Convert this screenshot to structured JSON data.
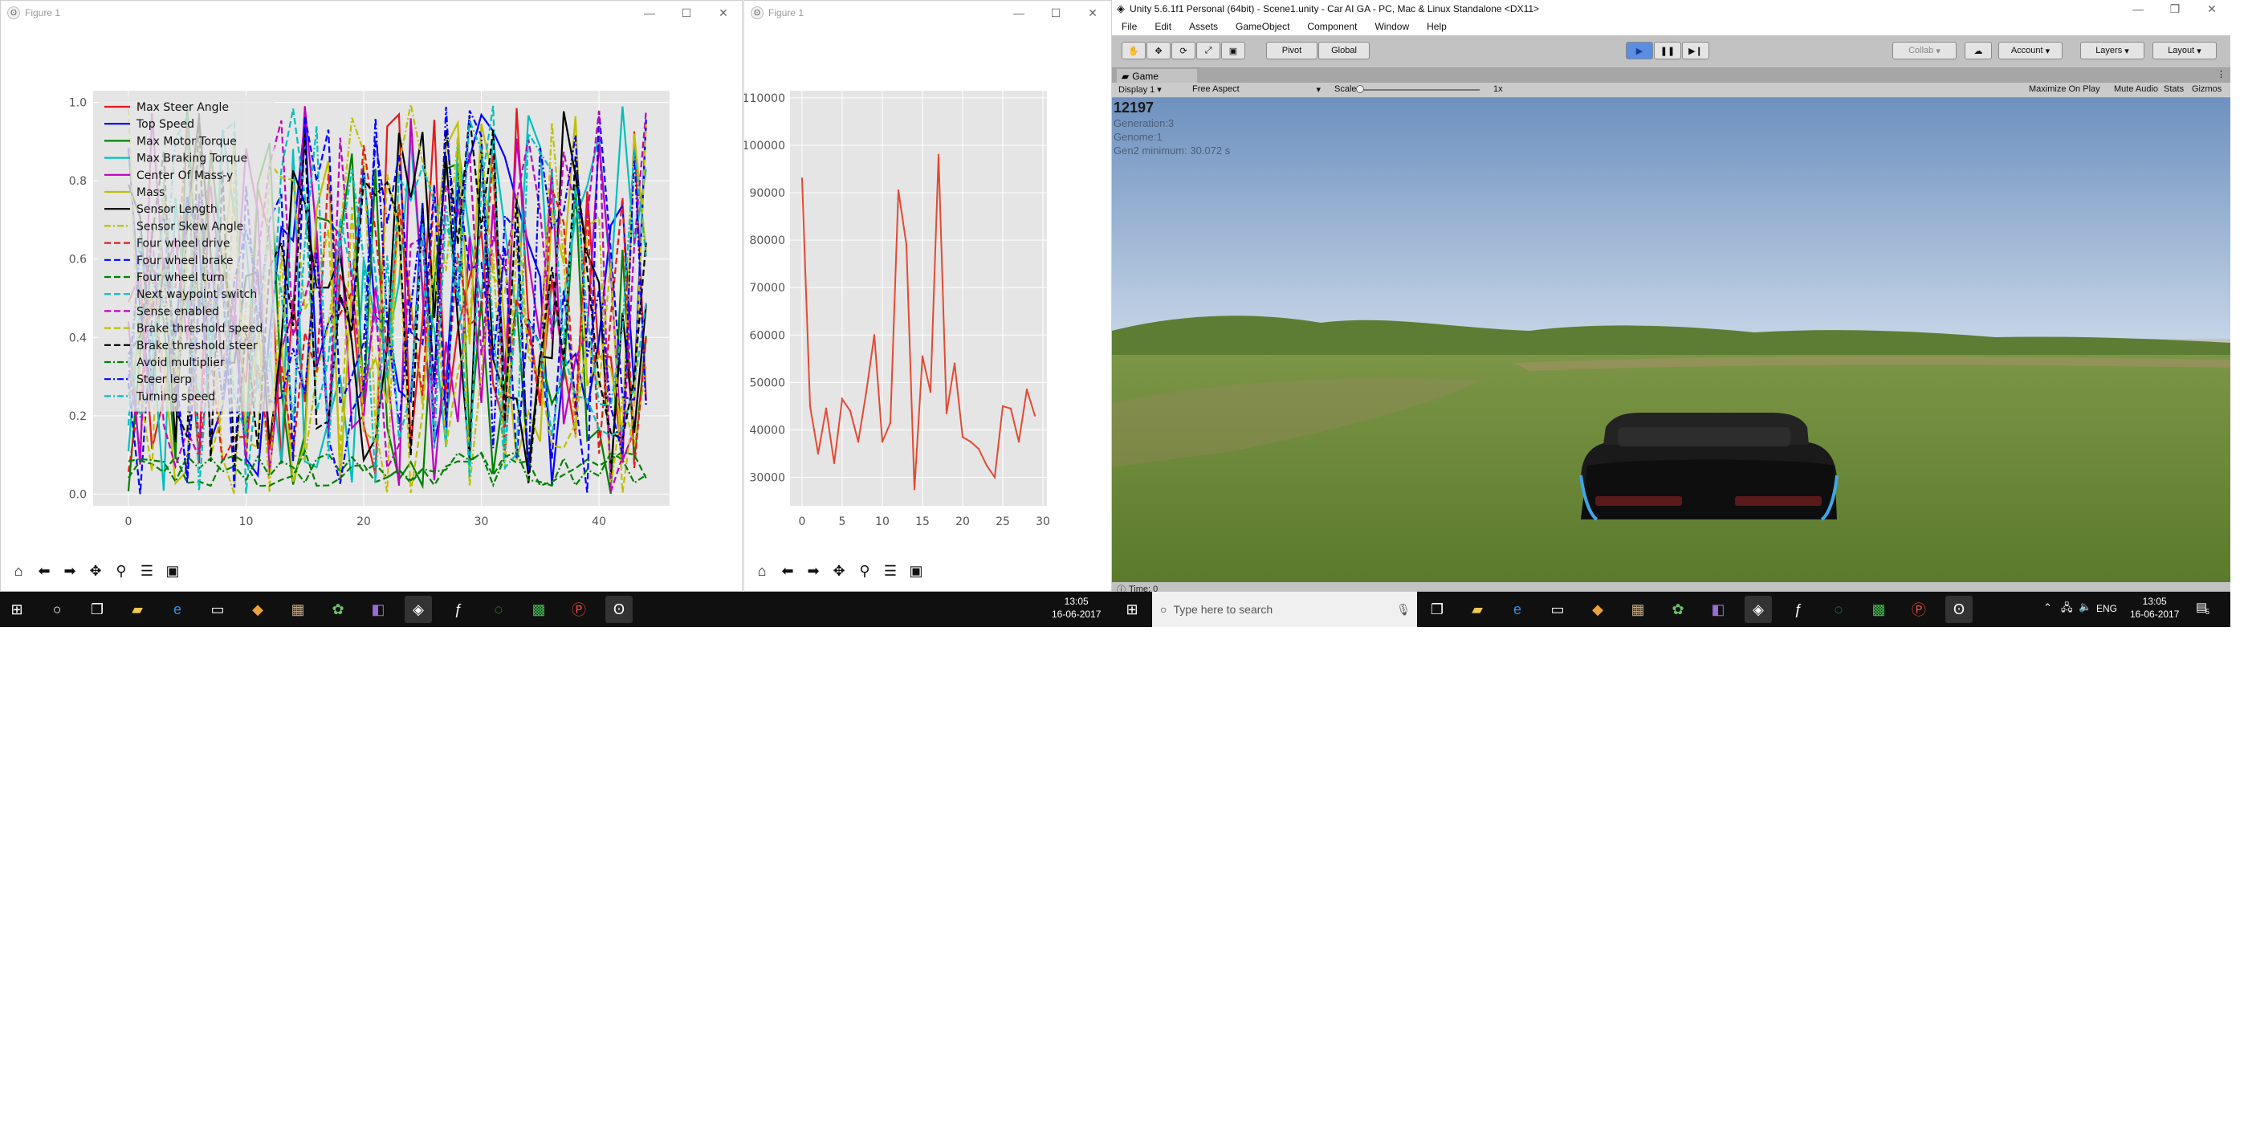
{
  "figure1": {
    "title": "Figure 1",
    "legend": [
      "Max Steer Angle",
      "Top Speed",
      "Max Motor Torque",
      "Max Braking Torque",
      "Center Of Mass-y",
      "Mass",
      "Sensor Length",
      "Sensor Skew Angle",
      "Four wheel drive",
      "Four wheel brake",
      "Four wheel turn",
      "Next waypoint switch",
      "Sense enabled",
      "Brake threshold speed",
      "Brake threshold steer",
      "Avoid multiplier",
      "Steer lerp",
      "Turning speed"
    ]
  },
  "figure2": {
    "title": "Figure 1"
  },
  "chart_data": [
    {
      "type": "line",
      "x": [
        0,
        44
      ],
      "xticks": [
        "0",
        "10",
        "20",
        "30",
        "40"
      ],
      "yticks": [
        "0.0",
        "0.2",
        "0.4",
        "0.6",
        "0.8",
        "1.0"
      ],
      "xlim": [
        -3,
        46
      ],
      "ylim": [
        -0.03,
        1.03
      ],
      "grid": true,
      "legend_position": "upper-left",
      "series": [
        {
          "name": "Max Steer Angle",
          "color": "#e41a1c",
          "style": "solid"
        },
        {
          "name": "Top Speed",
          "color": "#0000ff",
          "style": "solid"
        },
        {
          "name": "Max Motor Torque",
          "color": "#008000",
          "style": "solid"
        },
        {
          "name": "Max Braking Torque",
          "color": "#00bfbf",
          "style": "solid"
        },
        {
          "name": "Center Of Mass-y",
          "color": "#bf00bf",
          "style": "solid"
        },
        {
          "name": "Mass",
          "color": "#bfbf00",
          "style": "solid"
        },
        {
          "name": "Sensor Length",
          "color": "#000000",
          "style": "solid"
        },
        {
          "name": "Sensor Skew Angle",
          "color": "#bfbf00",
          "style": "dashdot"
        },
        {
          "name": "Four wheel drive",
          "color": "#e41a1c",
          "style": "dashed"
        },
        {
          "name": "Four wheel brake",
          "color": "#0000ff",
          "style": "dashed"
        },
        {
          "name": "Four wheel turn",
          "color": "#008000",
          "style": "dashed"
        },
        {
          "name": "Next waypoint switch",
          "color": "#00bfbf",
          "style": "dashed"
        },
        {
          "name": "Sense enabled",
          "color": "#bf00bf",
          "style": "dashed"
        },
        {
          "name": "Brake threshold speed",
          "color": "#bfbf00",
          "style": "dashed"
        },
        {
          "name": "Brake threshold steer",
          "color": "#000000",
          "style": "dashed"
        },
        {
          "name": "Avoid multiplier",
          "color": "#008000",
          "style": "dashdot"
        },
        {
          "name": "Steer lerp",
          "color": "#0000ff",
          "style": "dashdot"
        },
        {
          "name": "Turning speed",
          "color": "#00bfbf",
          "style": "dashdot"
        }
      ]
    },
    {
      "type": "line",
      "x": [
        0,
        1,
        2,
        3,
        4,
        5,
        6,
        7,
        8,
        9,
        10,
        11,
        12,
        13,
        14,
        15,
        16,
        17,
        18,
        19,
        20,
        21,
        22,
        23,
        24,
        25,
        26,
        27,
        28,
        29
      ],
      "values": [
        93000,
        45000,
        35000,
        44500,
        33000,
        46500,
        44000,
        37500,
        48000,
        60000,
        37500,
        41500,
        90500,
        79000,
        27500,
        55500,
        48000,
        98000,
        43500,
        54000,
        38500,
        37500,
        36000,
        32500,
        30000,
        45000,
        44500,
        37500,
        48500,
        43000
      ],
      "xticks": [
        "0",
        "5",
        "10",
        "15",
        "20",
        "25",
        "30"
      ],
      "yticks": [
        "30000",
        "40000",
        "50000",
        "60000",
        "70000",
        "80000",
        "90000",
        "100000",
        "110000"
      ],
      "xlim": [
        -1.5,
        30.5
      ],
      "ylim": [
        24000,
        111500
      ],
      "grid": true,
      "color": "#e24a33"
    }
  ],
  "unity": {
    "title": "Unity 5.6.1f1 Personal (64bit) - Scene1.unity - Car AI GA - PC, Mac & Linux Standalone <DX11>",
    "menu": [
      "File",
      "Edit",
      "Assets",
      "GameObject",
      "Component",
      "Window",
      "Help"
    ],
    "pivot": "Pivot",
    "global": "Global",
    "collab": "Collab",
    "account": "Account",
    "layers": "Layers",
    "layout": "Layout",
    "game_tab": "Game",
    "display": "Display 1",
    "aspect": "Free Aspect",
    "scale_label": "Scale",
    "scale_value": "1x",
    "maximize": "Maximize On Play",
    "mute": "Mute Audio",
    "stats": "Stats",
    "gizmos": "Gizmos",
    "score": "12197",
    "generation": "Generation:3",
    "genome": "Genome:1",
    "gen_min": "Gen2 minimum: 30.072 s",
    "time": "Time: 0"
  },
  "taskbar": {
    "time": "13:05",
    "date": "16-06-2017",
    "search_placeholder": "Type here to search",
    "lang": "ENG",
    "notif_count": "5"
  }
}
